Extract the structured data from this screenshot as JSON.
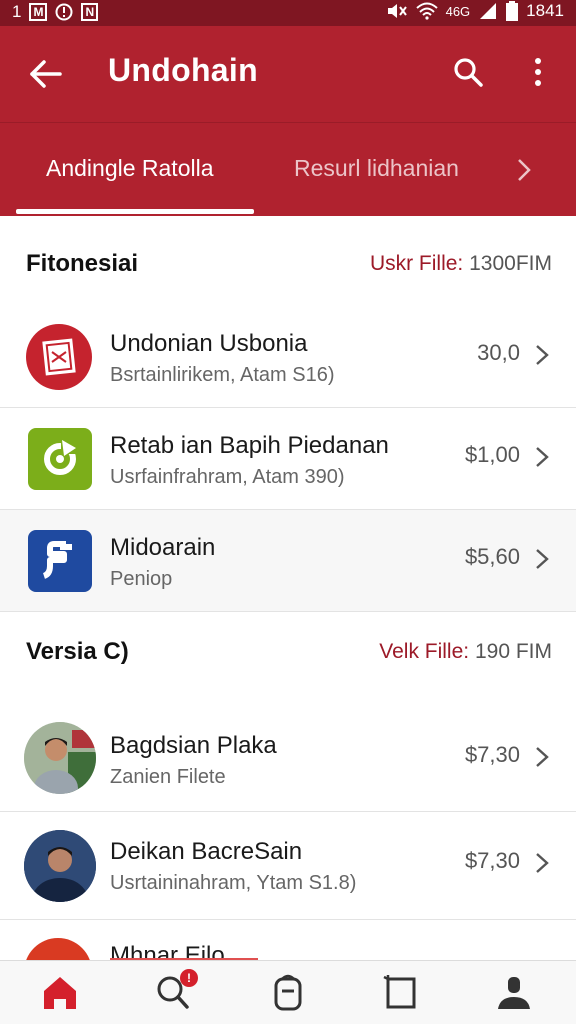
{
  "status_bar": {
    "left_num": "1",
    "network_label": "46G",
    "time": "1841"
  },
  "app_bar": {
    "title": "Undohain",
    "back_icon": "arrow-left-icon",
    "search_icon": "search-icon",
    "more_icon": "more-vert-icon"
  },
  "tabs": [
    {
      "label": "Andingle Ratolla",
      "active": true
    },
    {
      "label": "Resurl lidhanian",
      "active": false
    }
  ],
  "sections": [
    {
      "title": "Fitonesiai",
      "meta_label": "Uskr Fille:",
      "meta_value": "1300FIM",
      "items": [
        {
          "name": "Undonian Usbonia",
          "sub": "Bsrtainlirikem, Atam S16)",
          "price": "30,0",
          "icon": "red-box-app-icon"
        },
        {
          "name": "Retab ian Bapih Piedanan",
          "sub": "Usrfainfrahram, Atam 390)",
          "price": "$1,00",
          "icon": "green-refresh-app-icon"
        },
        {
          "name": "Midoarain",
          "sub": "Peniop",
          "price": "$5,60",
          "icon": "blue-f-app-icon"
        }
      ]
    },
    {
      "title": "Versia C)",
      "meta_label": "Velk Fille:",
      "meta_value": "190 FIM",
      "items": [
        {
          "name": "Bagdsian Plaka",
          "sub": "Zanien Filete",
          "price": "$7,30",
          "icon": "person-avatar"
        },
        {
          "name": "Deikan BacreSain",
          "sub": "Usrtaininahram, Ytam S1.8)",
          "price": "$7,30",
          "icon": "person-avatar"
        }
      ]
    }
  ],
  "partial_item": {
    "name": "Mhnar Eilo"
  },
  "bottom_nav": {
    "items": [
      "home-icon",
      "search-icon",
      "bag-icon",
      "crop-square-icon",
      "profile-icon"
    ],
    "badge": "!"
  },
  "colors": {
    "primary": "#b0222f",
    "status_bar": "#7f1622",
    "accent_text": "#9c1a28",
    "home_active": "#d4202c"
  }
}
